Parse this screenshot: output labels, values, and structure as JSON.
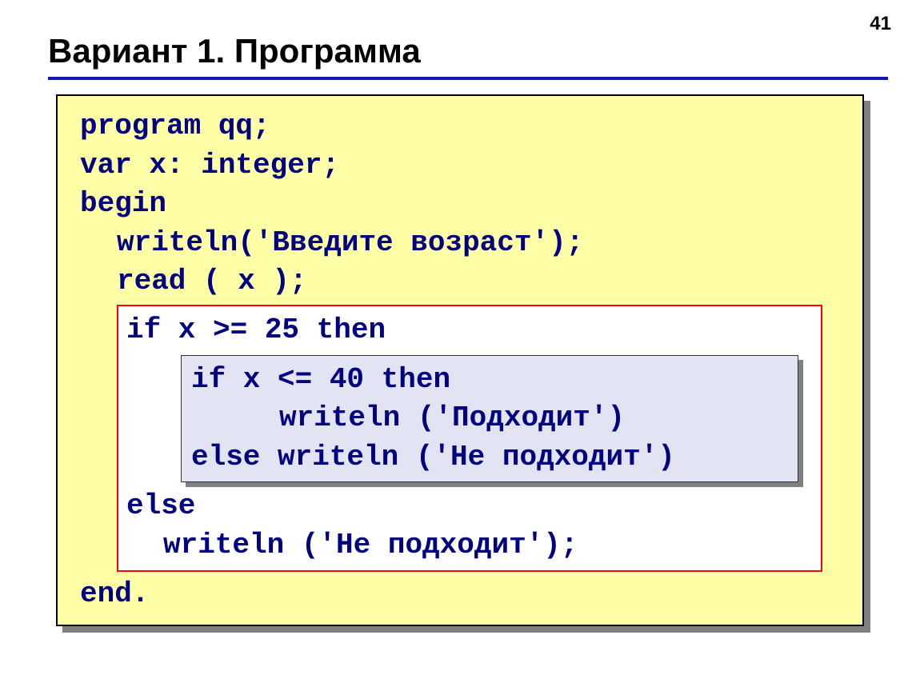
{
  "pageNumber": "41",
  "title": "Вариант 1. Программа",
  "code": {
    "l1": "program qq;",
    "l2": "var x: integer;",
    "l3": "begin",
    "l4": "writeln('Введите возраст');",
    "l5": "read ( x );",
    "red": {
      "l1": "if x >= 25 then",
      "blue": {
        "l1": "if x <= 40 then",
        "l2": "writeln ('Подходит')",
        "l3": "else writeln ('Не подходит')"
      },
      "l2": "else",
      "l3": "writeln ('Не подходит');"
    },
    "l6": "end."
  }
}
